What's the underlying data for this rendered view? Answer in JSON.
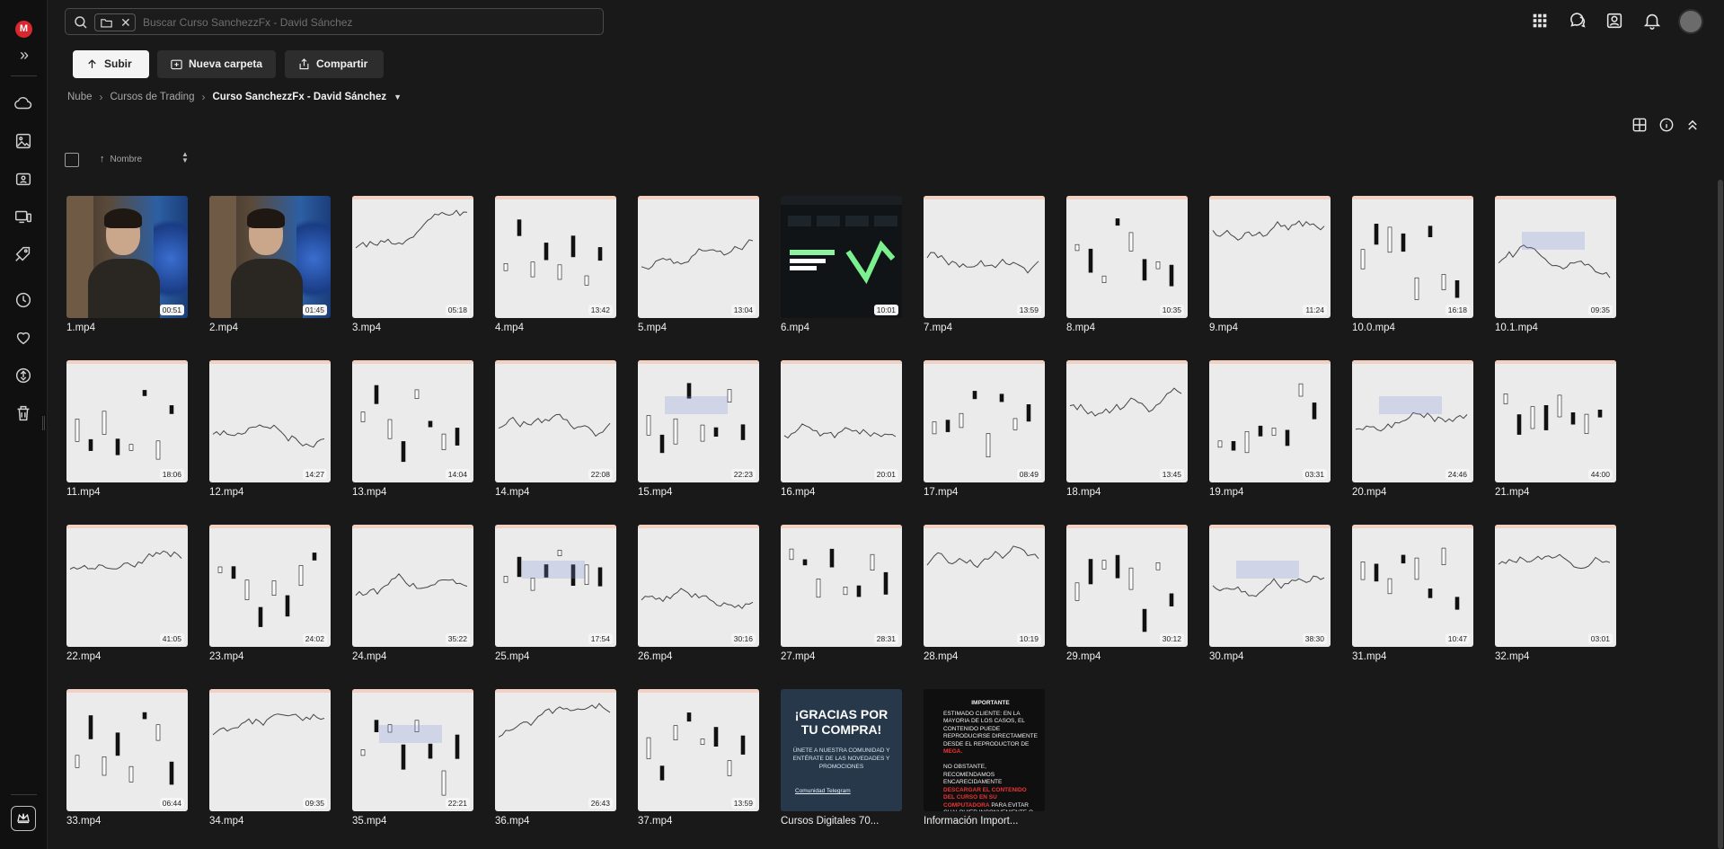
{
  "app": {
    "logo_letter": "M"
  },
  "search": {
    "placeholder": "Buscar Curso SanchezzFx - David Sánchez"
  },
  "toolbar": {
    "upload": "Subir",
    "new_folder": "Nueva carpeta",
    "share": "Compartir"
  },
  "breadcrumb": {
    "root": "Nube",
    "parent": "Cursos de Trading",
    "current": "Curso SanchezzFx - David Sánchez"
  },
  "sort": {
    "label": "Nombre"
  },
  "files": [
    {
      "name": "1.mp4",
      "duration": "00:51"
    },
    {
      "name": "2.mp4",
      "duration": "01:45"
    },
    {
      "name": "3.mp4",
      "duration": "05:18"
    },
    {
      "name": "4.mp4",
      "duration": "13:42"
    },
    {
      "name": "5.mp4",
      "duration": "13:04"
    },
    {
      "name": "6.mp4",
      "duration": "10:01"
    },
    {
      "name": "7.mp4",
      "duration": "13:59"
    },
    {
      "name": "8.mp4",
      "duration": "10:35"
    },
    {
      "name": "9.mp4",
      "duration": "11:24"
    },
    {
      "name": "10.0.mp4",
      "duration": "16:18"
    },
    {
      "name": "10.1.mp4",
      "duration": "09:35"
    },
    {
      "name": "11.mp4",
      "duration": "18:06"
    },
    {
      "name": "12.mp4",
      "duration": "14:27"
    },
    {
      "name": "13.mp4",
      "duration": "14:04"
    },
    {
      "name": "14.mp4",
      "duration": "22:08"
    },
    {
      "name": "15.mp4",
      "duration": "22:23"
    },
    {
      "name": "16.mp4",
      "duration": "20:01"
    },
    {
      "name": "17.mp4",
      "duration": "08:49"
    },
    {
      "name": "18.mp4",
      "duration": "13:45"
    },
    {
      "name": "19.mp4",
      "duration": "03:31"
    },
    {
      "name": "20.mp4",
      "duration": "24:46"
    },
    {
      "name": "21.mp4",
      "duration": "44:00"
    },
    {
      "name": "22.mp4",
      "duration": "41:05"
    },
    {
      "name": "23.mp4",
      "duration": "24:02"
    },
    {
      "name": "24.mp4",
      "duration": "35:22"
    },
    {
      "name": "25.mp4",
      "duration": "17:54"
    },
    {
      "name": "26.mp4",
      "duration": "30:16"
    },
    {
      "name": "27.mp4",
      "duration": "28:31"
    },
    {
      "name": "28.mp4",
      "duration": "10:19"
    },
    {
      "name": "29.mp4",
      "duration": "30:12"
    },
    {
      "name": "30.mp4",
      "duration": "38:30"
    },
    {
      "name": "31.mp4",
      "duration": "10:47"
    },
    {
      "name": "32.mp4",
      "duration": "03:01"
    },
    {
      "name": "33.mp4",
      "duration": "06:44"
    },
    {
      "name": "34.mp4",
      "duration": "09:35"
    },
    {
      "name": "35.mp4",
      "duration": "22:21"
    },
    {
      "name": "36.mp4",
      "duration": "26:43"
    },
    {
      "name": "37.mp4",
      "duration": "13:59"
    },
    {
      "name": "Cursos Digitales 70...",
      "duration": ""
    },
    {
      "name": "Información Import...",
      "duration": ""
    }
  ],
  "promo": {
    "title": "¡GRACIAS POR TU COMPRA!",
    "subtitle": "ÚNETE A NUESTRA COMUNIDAD Y ENTÉRATE DE LAS NOVEDADES Y PROMOCIONES",
    "link": "Comunidad Telegram"
  },
  "info": {
    "title": "IMPORTANTE",
    "text_a": "ESTIMADO CLIENTE: EN LA MAYORIA DE LOS CASOS, EL CONTENIDO PUEDE REPRODUCIRSE DIRECTAMENTE DESDE EL REPRODUCTOR DE",
    "text_a_red": "MEGA.",
    "text_b": "NO OBSTANTE, RECOMENDAMOS ENCARECIDAMENTE",
    "text_b_red": "DESCARGAR EL CONTENIDO DEL CURSO EN SU COMPUTADORA",
    "text_c": "PARA EVITAR CUALQUIER INCONVENIENTE O EVENTUALIDAD EN EL ACCESO."
  }
}
